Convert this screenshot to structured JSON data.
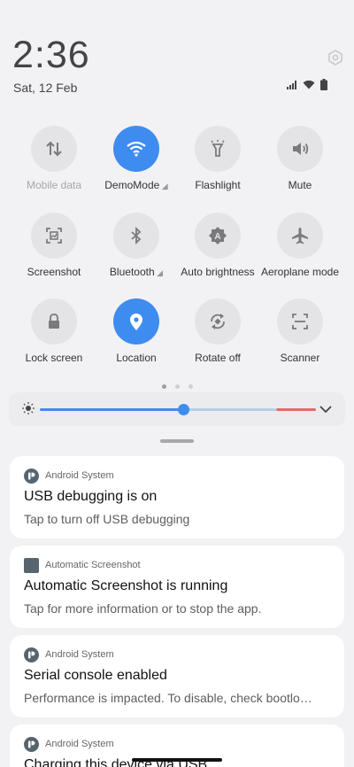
{
  "status": {
    "time": "2:36",
    "date": "Sat, 12 Feb",
    "icons": [
      "signal-icon",
      "wifi-icon",
      "battery-icon"
    ]
  },
  "tiles": [
    {
      "label": "Mobile data",
      "icon": "mobile-data-icon",
      "active": false,
      "disabled": true
    },
    {
      "label": "DemoMode",
      "icon": "wifi-icon",
      "active": true,
      "disabled": false
    },
    {
      "label": "Flashlight",
      "icon": "flashlight-icon",
      "active": false,
      "disabled": false
    },
    {
      "label": "Mute",
      "icon": "volume-icon",
      "active": false,
      "disabled": false
    },
    {
      "label": "Screenshot",
      "icon": "screenshot-icon",
      "active": false,
      "disabled": false
    },
    {
      "label": "Bluetooth",
      "icon": "bluetooth-icon",
      "active": false,
      "disabled": false
    },
    {
      "label": "Auto brightness",
      "icon": "auto-brightness-icon",
      "active": false,
      "disabled": false
    },
    {
      "label": "Aeroplane mode",
      "icon": "airplane-icon",
      "active": false,
      "disabled": false
    },
    {
      "label": "Lock screen",
      "icon": "lock-icon",
      "active": false,
      "disabled": false
    },
    {
      "label": "Location",
      "icon": "location-icon",
      "active": true,
      "disabled": false
    },
    {
      "label": "Rotate off",
      "icon": "rotate-icon",
      "active": false,
      "disabled": false
    },
    {
      "label": "Scanner",
      "icon": "scanner-icon",
      "active": false,
      "disabled": false
    }
  ],
  "pager": {
    "pages": 3,
    "current": 1
  },
  "brightness": {
    "level": 0.47
  },
  "notifications": [
    {
      "app": "Android System",
      "icon": "android-system-icon",
      "title": "USB debugging is on",
      "body": "Tap to turn off USB debugging"
    },
    {
      "app": "Automatic Screenshot",
      "icon": "app-square-icon",
      "title": "Automatic Screenshot is running",
      "body": "Tap for more information or to stop the app."
    },
    {
      "app": "Android System",
      "icon": "android-system-icon",
      "title": "Serial console enabled",
      "body": "Performance is impacted. To disable, check bootlo…"
    },
    {
      "app": "Android System",
      "icon": "android-system-icon",
      "title": "Charging this device via USB",
      "body": ""
    }
  ],
  "colors": {
    "accent": "#3f8cf0",
    "tile_bg": "#e4e4e6",
    "panel_bg": "#f2f2f4",
    "warning_track": "#e36b6b"
  }
}
